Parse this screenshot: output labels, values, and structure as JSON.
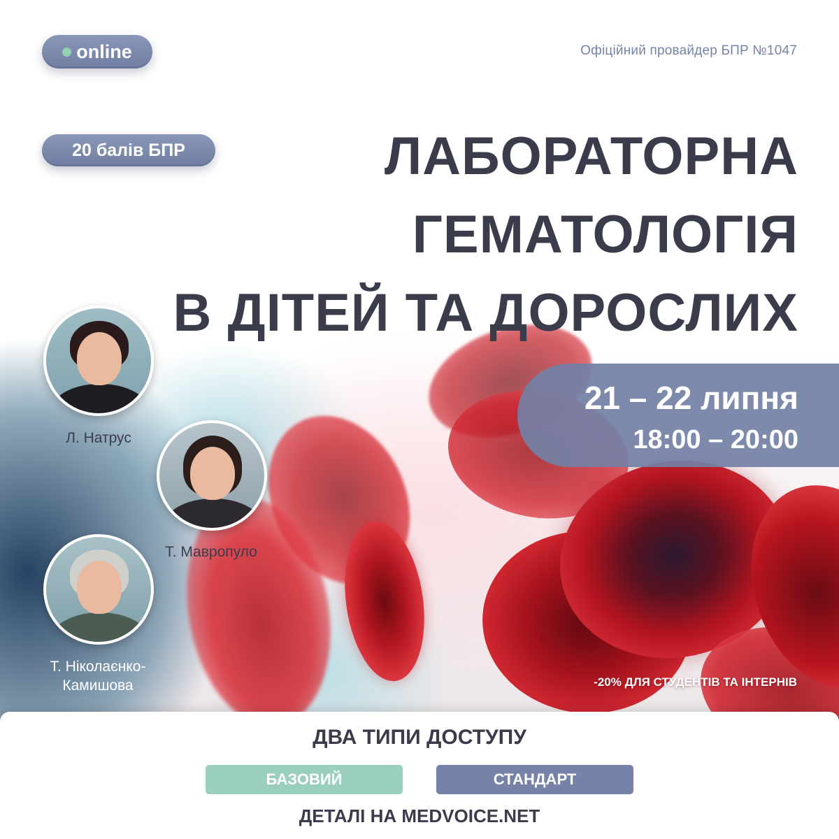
{
  "badges": {
    "online_label": "online",
    "points_label": "20 балів БПР"
  },
  "provider_text": "Офіційний провайдер БПР №1047",
  "title_lines": [
    "ЛАБОРАТОРНА",
    "ГЕМАТОЛОГІЯ",
    "В ДІТЕЙ ТА ДОРОСЛИХ"
  ],
  "schedule": {
    "dates": "21 – 22 липня",
    "time": "18:00 – 20:00"
  },
  "speakers": [
    {
      "name": "Л. Натрус"
    },
    {
      "name": "Т. Мавропуло"
    },
    {
      "name_line1": "Т. Ніколаєнко-",
      "name_line2": "Камишова"
    }
  ],
  "discount_text": "-20% ДЛЯ СТУДЕНТІВ ТА ІНТЕРНІВ",
  "access": {
    "title": "ДВА ТИПИ ДОСТУПУ",
    "options": [
      "БАЗОВИЙ",
      "СТАНДАРТ"
    ]
  },
  "details_text": "ДЕТАЛІ НА MEDVOICE.NET",
  "colors": {
    "accent": "#7682a8",
    "basic_option": "#9bcfbd",
    "title_text": "#3b3c4b",
    "online_dot": "#8fd3b0"
  },
  "icons": [
    "status-dot-icon",
    "red-blood-cells-image"
  ]
}
